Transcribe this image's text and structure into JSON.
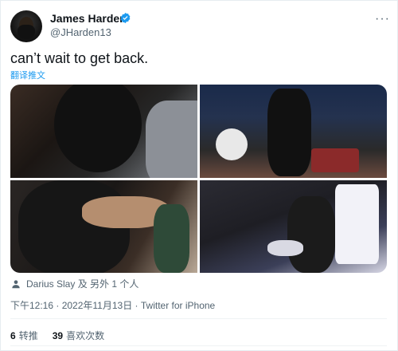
{
  "author": {
    "display_name": "James Harden",
    "handle": "@JHarden13",
    "verified": true
  },
  "tweet": {
    "text": "can’t wait to get back.",
    "translate_label": "翻译推文"
  },
  "tags": {
    "text": "Darius Slay 及 另外 1 个人"
  },
  "meta": {
    "timestamp": "下午12:16 · 2022年11月13日 · Twitter for iPhone"
  },
  "stats": {
    "retweets_count": "6",
    "retweets_label": "转推",
    "likes_count": "39",
    "likes_label": "喜欢次数"
  },
  "colors": {
    "accent": "#1d9bf0",
    "text": "#0f1419",
    "secondary": "#536471"
  },
  "icons": {
    "verified": "verified-badge-icon",
    "more": "more-options-icon",
    "tag": "person-icon"
  }
}
